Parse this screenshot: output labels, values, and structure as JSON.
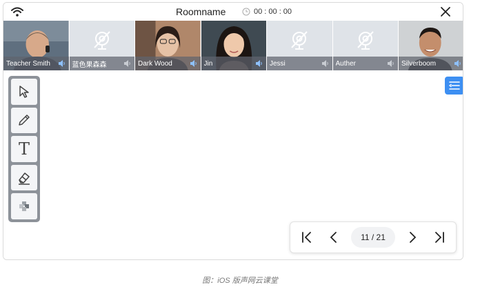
{
  "header": {
    "room_name": "Roomname",
    "timer": "00 : 00 : 00"
  },
  "participants": [
    {
      "name": "Teacher Smith",
      "video": true
    },
    {
      "name": "蓝色果森森",
      "video": false
    },
    {
      "name": "Dark Wood",
      "video": true
    },
    {
      "name": "Jin",
      "video": true
    },
    {
      "name": "Jessi",
      "video": false
    },
    {
      "name": "Auther",
      "video": false
    },
    {
      "name": "Silverboom",
      "video": true
    }
  ],
  "pager": {
    "page_label": "11 / 21"
  },
  "caption": "图：iOS 版声网云课堂",
  "colors": {
    "accent": "#3d8ff2",
    "toolbox": "#8d9299",
    "name_bar": "#5f646e"
  }
}
